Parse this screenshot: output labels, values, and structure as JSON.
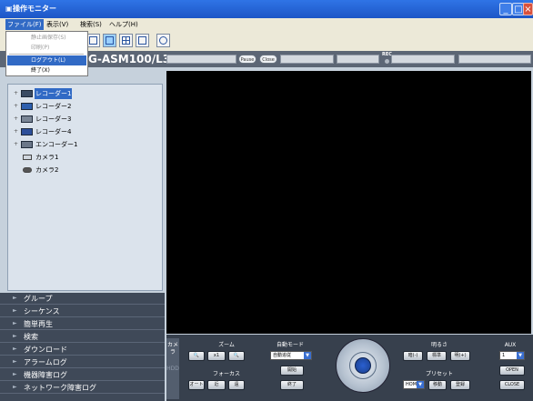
{
  "window": {
    "title": "操作モニター"
  },
  "menubar": {
    "items": [
      "ファイル(F)",
      "表示(V)",
      "検索(S)",
      "ヘルプ(H)"
    ]
  },
  "file_menu": {
    "items": [
      "静止画保存(S)",
      "印刷(P)",
      "ログアウト(L)",
      "終了(X)"
    ]
  },
  "camera_header": {
    "name": "G-ASM100/L3",
    "pill_left": "Pause",
    "pill_right": "Close",
    "rec_label": "REC"
  },
  "tree": {
    "items": [
      "レコーダー1",
      "レコーダー2",
      "レコーダー3",
      "レコーダー4",
      "エンコーダー1",
      "カメラ1",
      "カメラ2"
    ]
  },
  "nav": {
    "items": [
      "グループ",
      "シーケンス",
      "簡単再生",
      "検索",
      "ダウンロード",
      "アラームログ",
      "機器障害ログ",
      "ネットワーク障害ログ"
    ]
  },
  "controls": {
    "side_tab_top": "カメラ",
    "side_tab_bottom": "HDD",
    "zoom_label": "ズーム",
    "zoom_x1": "x1",
    "focus_label": "フォーカス",
    "focus_auto": "オート",
    "focus_near": "近",
    "focus_far": "遠",
    "automode_label": "自動モード",
    "automode_value": "自動追従",
    "start_button": "開始",
    "stop_button": "終了",
    "brightness_label": "明るさ",
    "bright_dark": "暗(-)",
    "bright_std": "標準",
    "bright_light": "明(+)",
    "preset_label": "プリセット",
    "preset_value": "HOME",
    "preset_go": "移動",
    "preset_register": "登録",
    "aux_label": "AUX",
    "aux_value": "1",
    "aux_open": "OPEN",
    "aux_close": "CLOSE"
  },
  "colors": {
    "titlebar": "#1d56c6",
    "menu_highlight": "#316ac5",
    "video_bg": "#000000"
  }
}
